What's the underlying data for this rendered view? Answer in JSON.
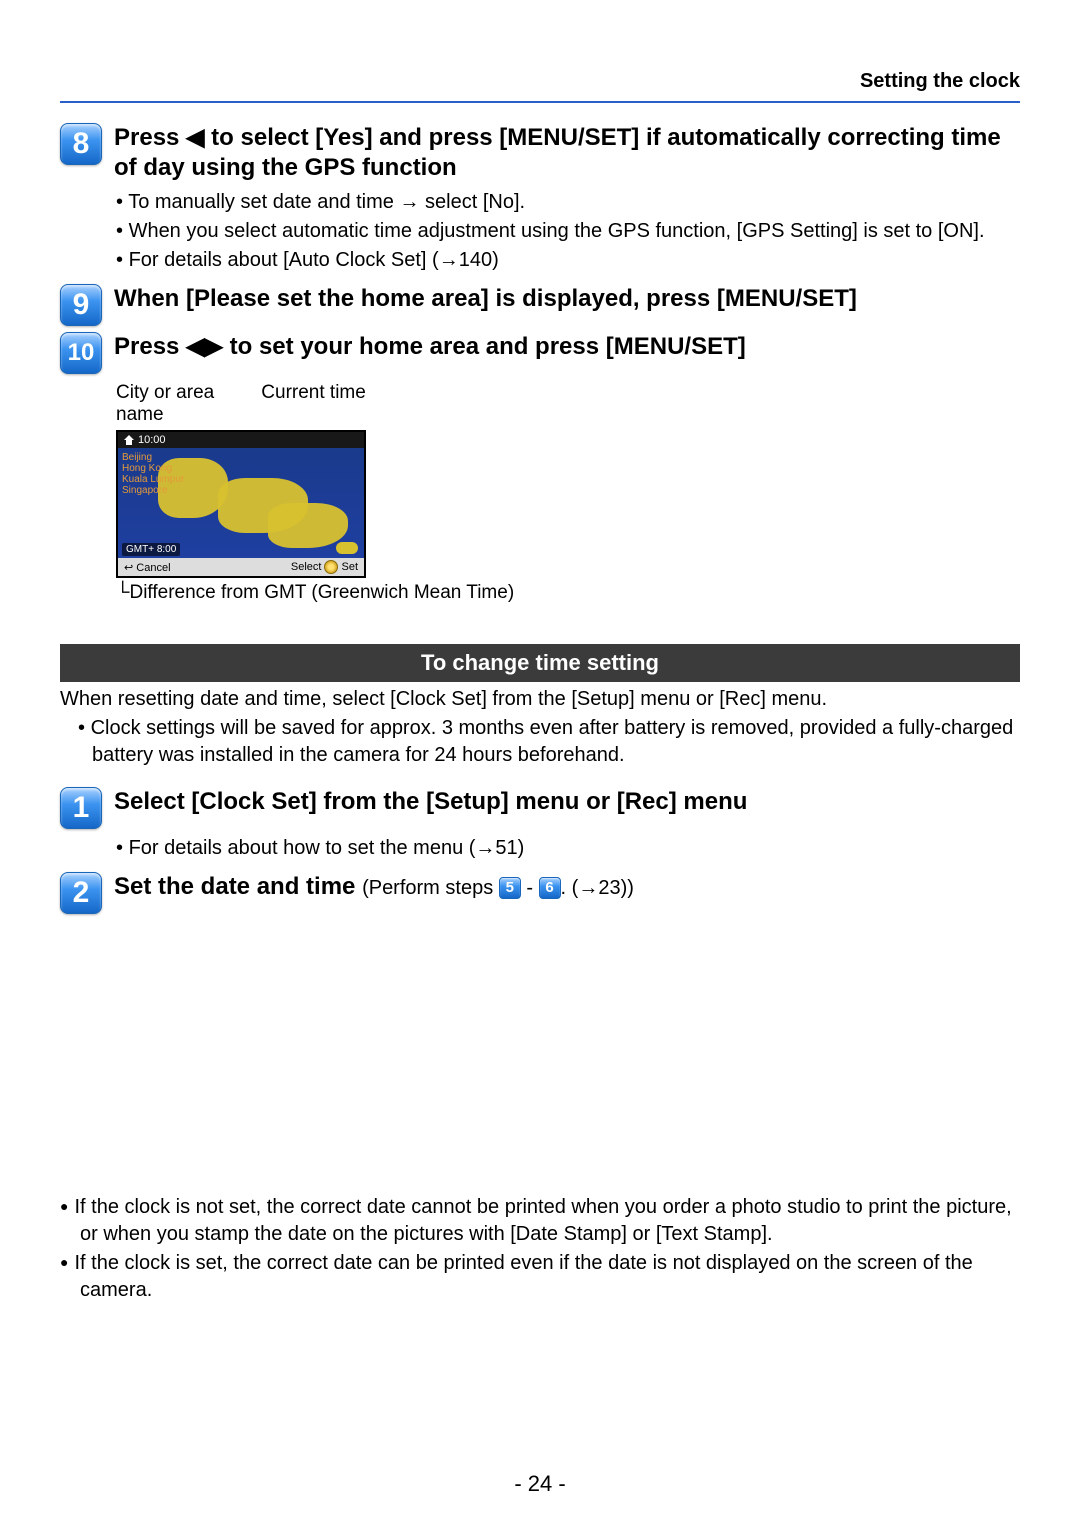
{
  "header": {
    "title": "Setting the clock"
  },
  "step8": {
    "num": "8",
    "heading": "Press ◀ to select [Yes] and press [MENU/SET] if automatically correcting time of day using the GPS function",
    "bullets": [
      "To manually set date and time → select [No].",
      "When you select automatic time adjustment using the GPS function, [GPS Setting] is set to [ON].",
      "For details about [Auto Clock Set] (→140)"
    ]
  },
  "step9": {
    "num": "9",
    "heading": "When [Please set the home area] is displayed, press [MENU/SET]"
  },
  "step10": {
    "num": "10",
    "heading": "Press ◀▶ to set your home area and press [MENU/SET]",
    "label_city": "City or area name",
    "label_time": "Current time",
    "lcd": {
      "clock": "10:00",
      "cities": [
        "Beijing",
        "Hong Kong",
        "Kuala Lumpur",
        "Singapore"
      ],
      "gmt": "GMT+ 8:00",
      "cancel": "Cancel",
      "select": "Select",
      "set": "Set"
    },
    "gmt_note": "Difference from GMT (Greenwich Mean Time)"
  },
  "section": {
    "title": "To change time setting",
    "intro": "When resetting date and time, select [Clock Set] from the [Setup] menu or [Rec] menu.",
    "bullet": "Clock settings will be saved for approx. 3 months even after battery is removed, provided a fully-charged battery was installed in the camera for 24 hours beforehand."
  },
  "step1": {
    "num": "1",
    "heading": "Select [Clock Set] from the [Setup] menu or [Rec] menu",
    "bullet": "For details about how to set the menu (→51)"
  },
  "step2": {
    "num": "2",
    "heading_a": "Set the date and time ",
    "heading_b": "(Perform steps ",
    "ref_a": "5",
    "dash": " - ",
    "ref_b": "6",
    "heading_c": ". (→23))"
  },
  "notes": [
    "If the clock is not set, the correct date cannot be printed when you order a photo studio to print the picture, or when you stamp the date on the pictures with [Date Stamp] or [Text Stamp].",
    "If the clock is set, the correct date can be printed even if the date is not displayed on the screen of the camera."
  ],
  "page_num": "- 24 -"
}
